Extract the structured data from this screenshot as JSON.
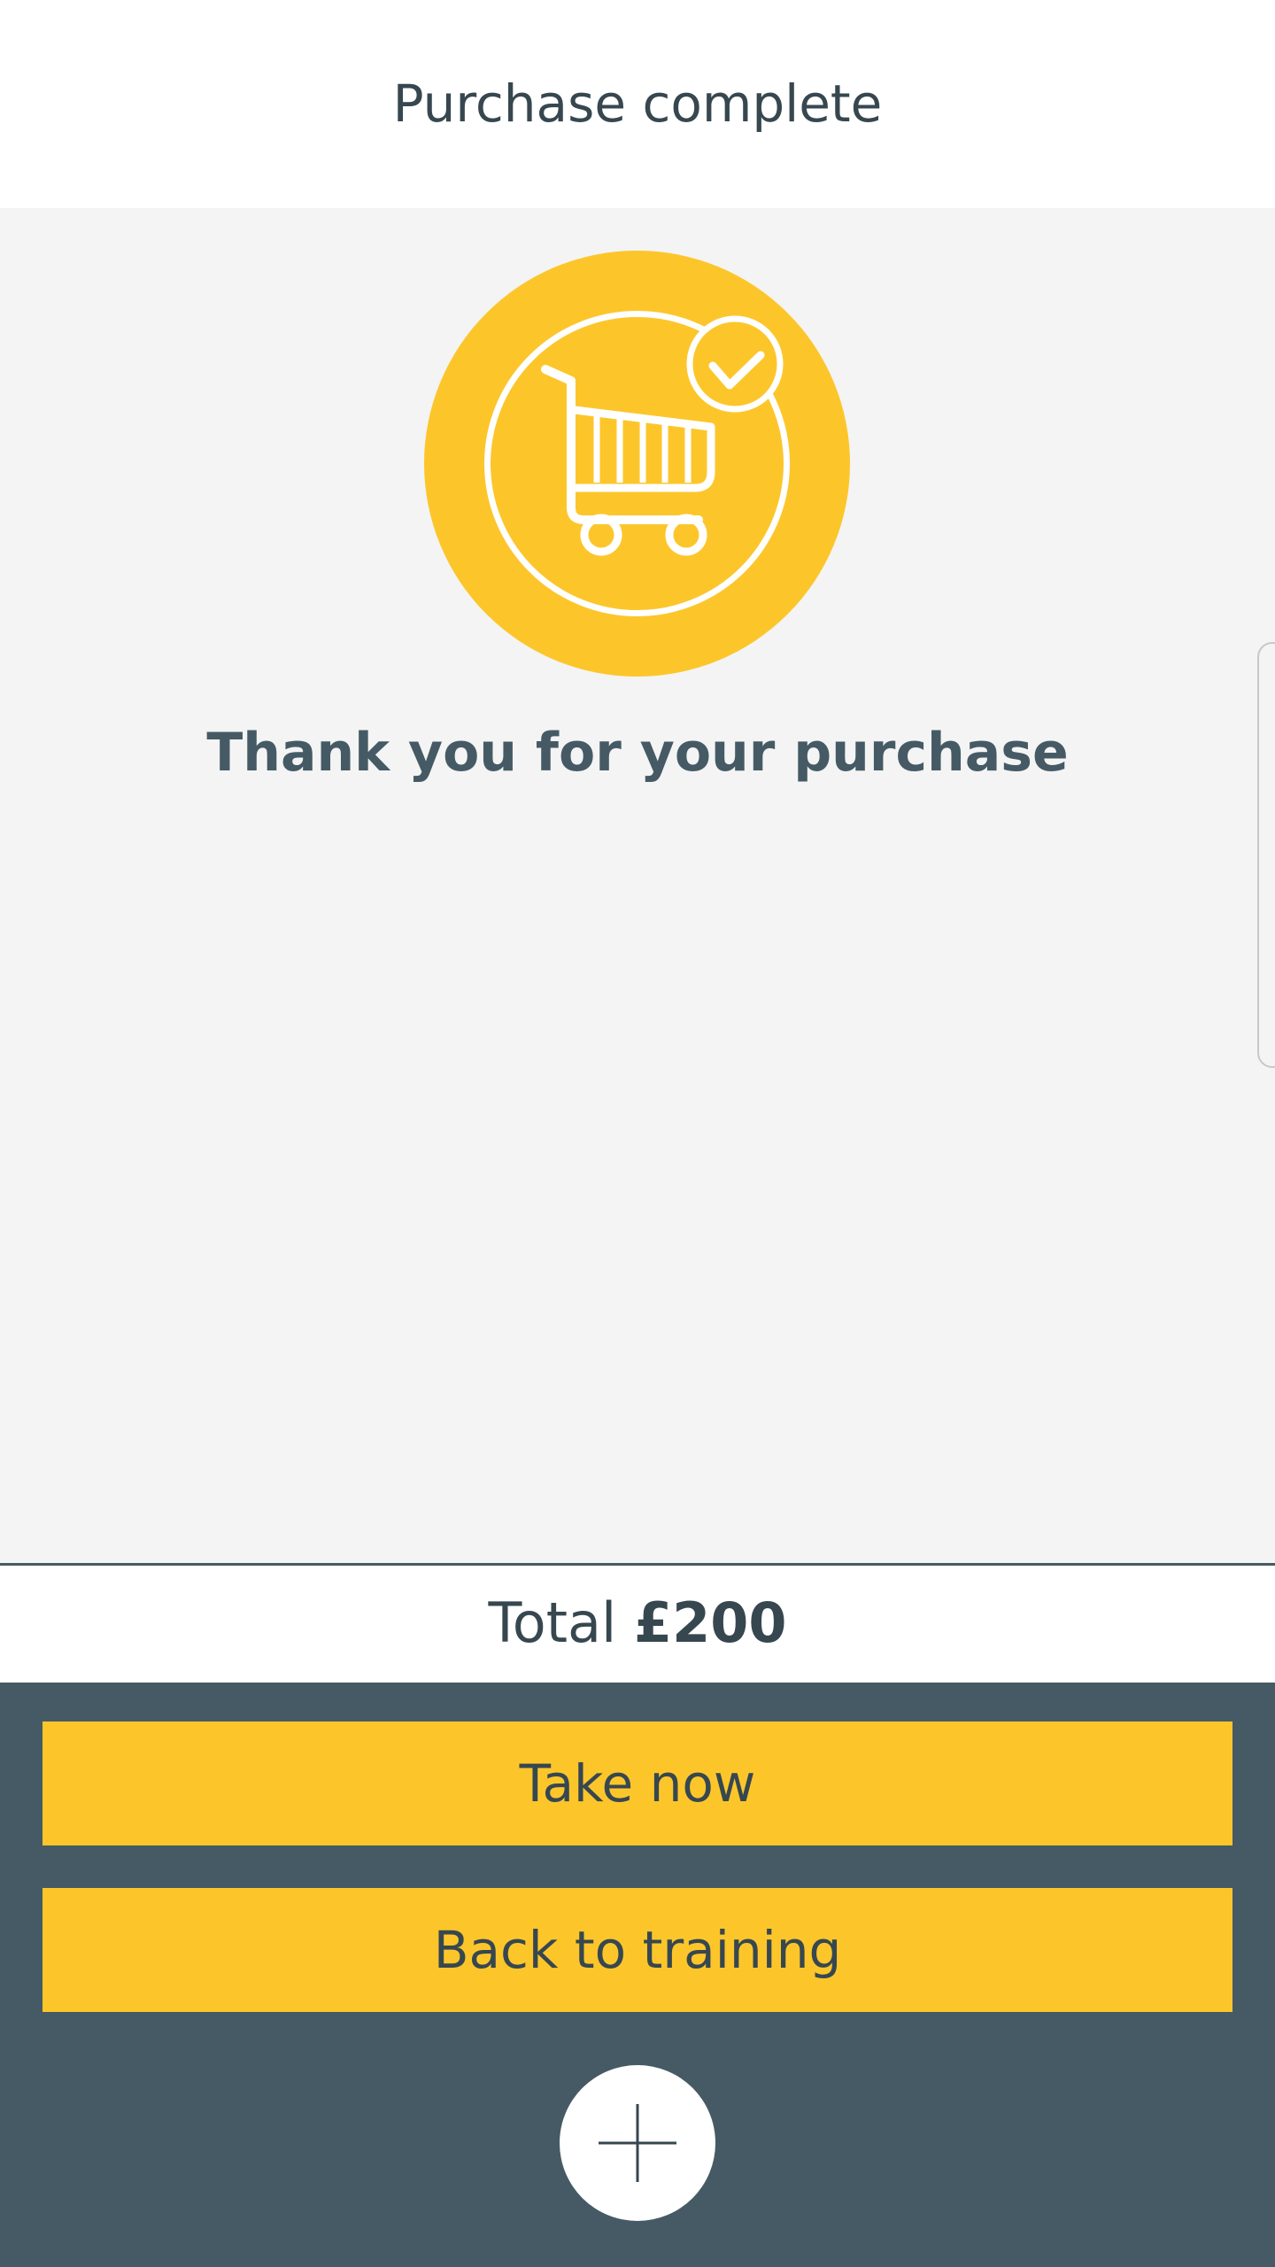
{
  "header": {
    "title": "Purchase complete"
  },
  "success": {
    "icon": "cart-check-icon",
    "message": "Thank you for your purchase"
  },
  "summary": {
    "total_label": "Total",
    "total_amount": "£200"
  },
  "actions": {
    "take_now_label": "Take now",
    "back_to_training_label": "Back to training",
    "fab_icon": "plus-icon"
  },
  "colors": {
    "accent": "#fcc62b",
    "dark": "#455a64",
    "text": "#37474f",
    "background": "#f4f4f4"
  }
}
